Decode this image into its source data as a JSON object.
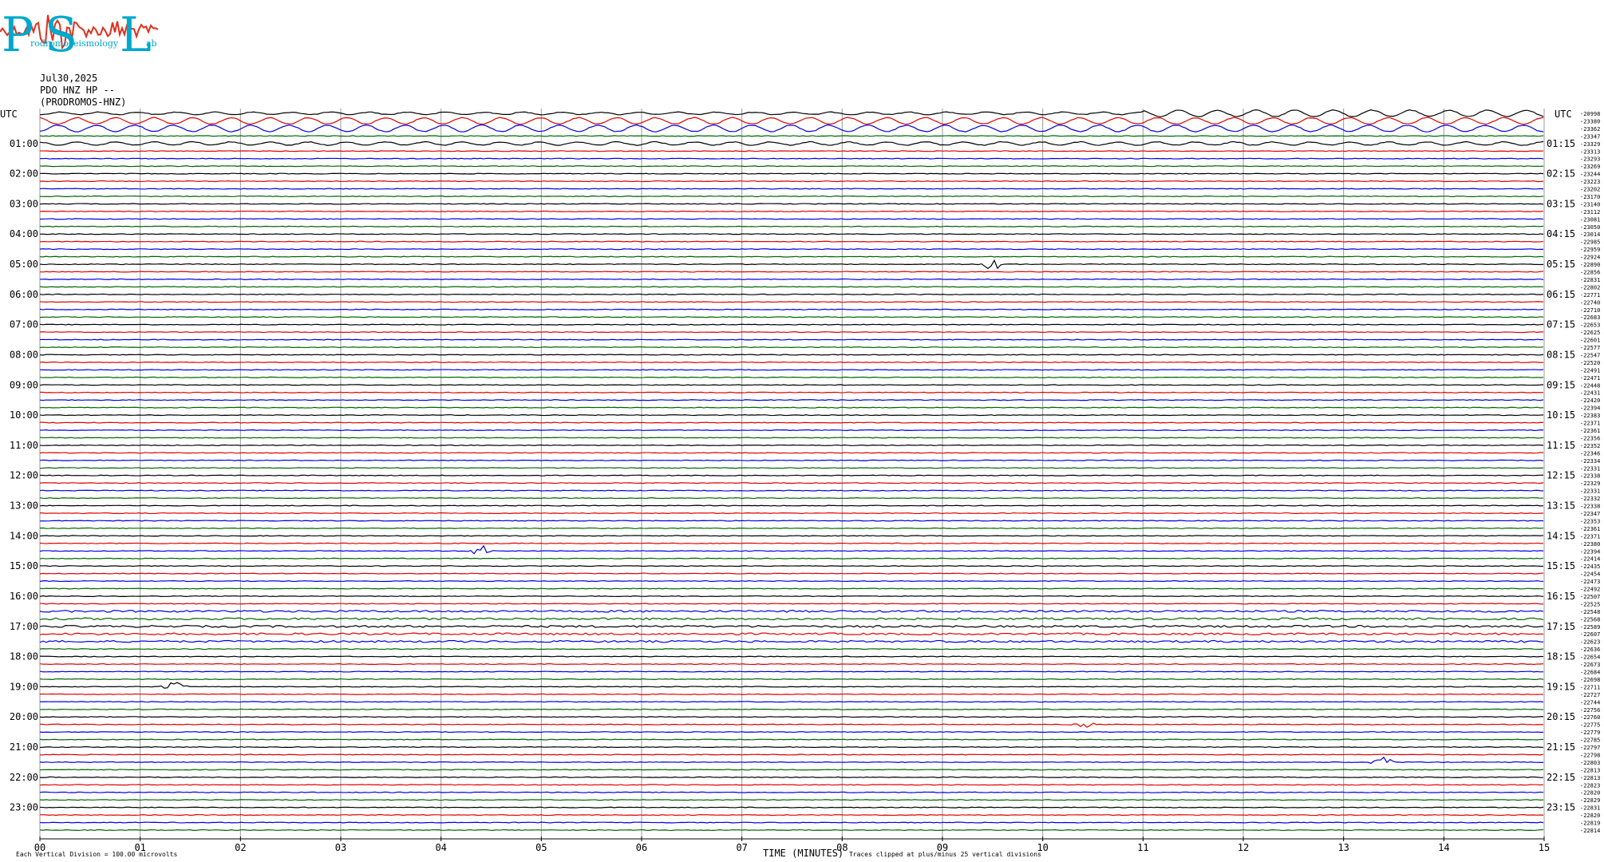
{
  "header": {
    "date": "Jul30,2025",
    "station": "PDO HNZ HP --",
    "site": "(PRODROMOS-HNZ)"
  },
  "logo": {
    "letters": [
      "P",
      "S",
      "L"
    ],
    "small_text": [
      "rodromos",
      "eismology",
      "ab"
    ],
    "colors": {
      "letters": "#00a8cc",
      "wave": "#e0301e"
    }
  },
  "axes": {
    "left_label": "UTC",
    "right_label": "UTC",
    "x_label": "TIME (MINUTES)",
    "footer_left": "Each Vertical Division =  100.00 microvolts",
    "footer_right": "Traces clipped at plus/minus 25 vertical divisions"
  },
  "chart_data": {
    "type": "line",
    "title": "",
    "x_ticks": [
      "00",
      "01",
      "02",
      "03",
      "04",
      "05",
      "06",
      "07",
      "08",
      "09",
      "10",
      "11",
      "12",
      "13",
      "14",
      "15"
    ],
    "xlim": [
      0,
      15
    ],
    "grid": true,
    "trace_colors": [
      "#000000",
      "#e00000",
      "#0000e0",
      "#006400"
    ],
    "left_hour_labels": [
      "01:00",
      "02:00",
      "03:00",
      "04:00",
      "05:00",
      "06:00",
      "07:00",
      "08:00",
      "09:00",
      "10:00",
      "11:00",
      "12:00",
      "13:00",
      "14:00",
      "15:00",
      "16:00",
      "17:00",
      "18:00",
      "19:00",
      "20:00",
      "21:00",
      "22:00",
      "23:00"
    ],
    "right_hour_labels": [
      "01:15",
      "02:15",
      "03:15",
      "04:15",
      "05:15",
      "06:15",
      "07:15",
      "08:15",
      "09:15",
      "10:15",
      "11:15",
      "12:15",
      "13:15",
      "14:15",
      "15:15",
      "16:15",
      "17:15",
      "18:15",
      "19:15",
      "20:15",
      "21:15",
      "22:15",
      "23:15"
    ],
    "trace_offsets": [
      -20998,
      -23380,
      -23362,
      -23347,
      -23329,
      -23313,
      -23293,
      -23269,
      -23244,
      -23223,
      -23202,
      -23170,
      -23140,
      -23112,
      -23081,
      -23050,
      -23014,
      -22985,
      -22959,
      -22924,
      -22890,
      -22856,
      -22831,
      -22802,
      -22771,
      -22740,
      -22710,
      -22683,
      -22653,
      -22625,
      -22601,
      -22577,
      -22547,
      -22520,
      -22491,
      -22471,
      -22448,
      -22431,
      -22420,
      -22394,
      -22383,
      -22371,
      -22361,
      -22356,
      -22352,
      -22346,
      -22334,
      -22331,
      -22338,
      -22329,
      -22331,
      -22332,
      -22338,
      -22347,
      -22353,
      -22361,
      -22371,
      -22380,
      -22394,
      -22414,
      -22435,
      -22454,
      -22473,
      -22492,
      -22507,
      -22525,
      -22548,
      -22568,
      -22589,
      -22607,
      -22623,
      -22636,
      -22654,
      -22673,
      -22684,
      -22698,
      -22711,
      -22727,
      -22744,
      -22756,
      -22760,
      -22775,
      -22779,
      -22785,
      -22797,
      -22798,
      -22803,
      -22813,
      -22813,
      -22823,
      -22820,
      -22829,
      -22831,
      -22820,
      -22819,
      -22814
    ],
    "events": [
      {
        "trace": 0,
        "type": "long-period waves"
      },
      {
        "trace": 1,
        "type": "long-period waves"
      },
      {
        "trace": 2,
        "type": "long-period waves"
      },
      {
        "trace": 4,
        "type": "long-period waves"
      },
      {
        "trace": 20,
        "minute": 9.5,
        "type": "burst"
      },
      {
        "trace": 58,
        "minute": 4.4,
        "type": "burst"
      },
      {
        "trace": 76,
        "minute": 1.35,
        "type": "burst"
      },
      {
        "trace": 81,
        "minute": 10.4,
        "type": "burst"
      },
      {
        "trace": 86,
        "minute": 13.4,
        "type": "burst"
      }
    ]
  }
}
